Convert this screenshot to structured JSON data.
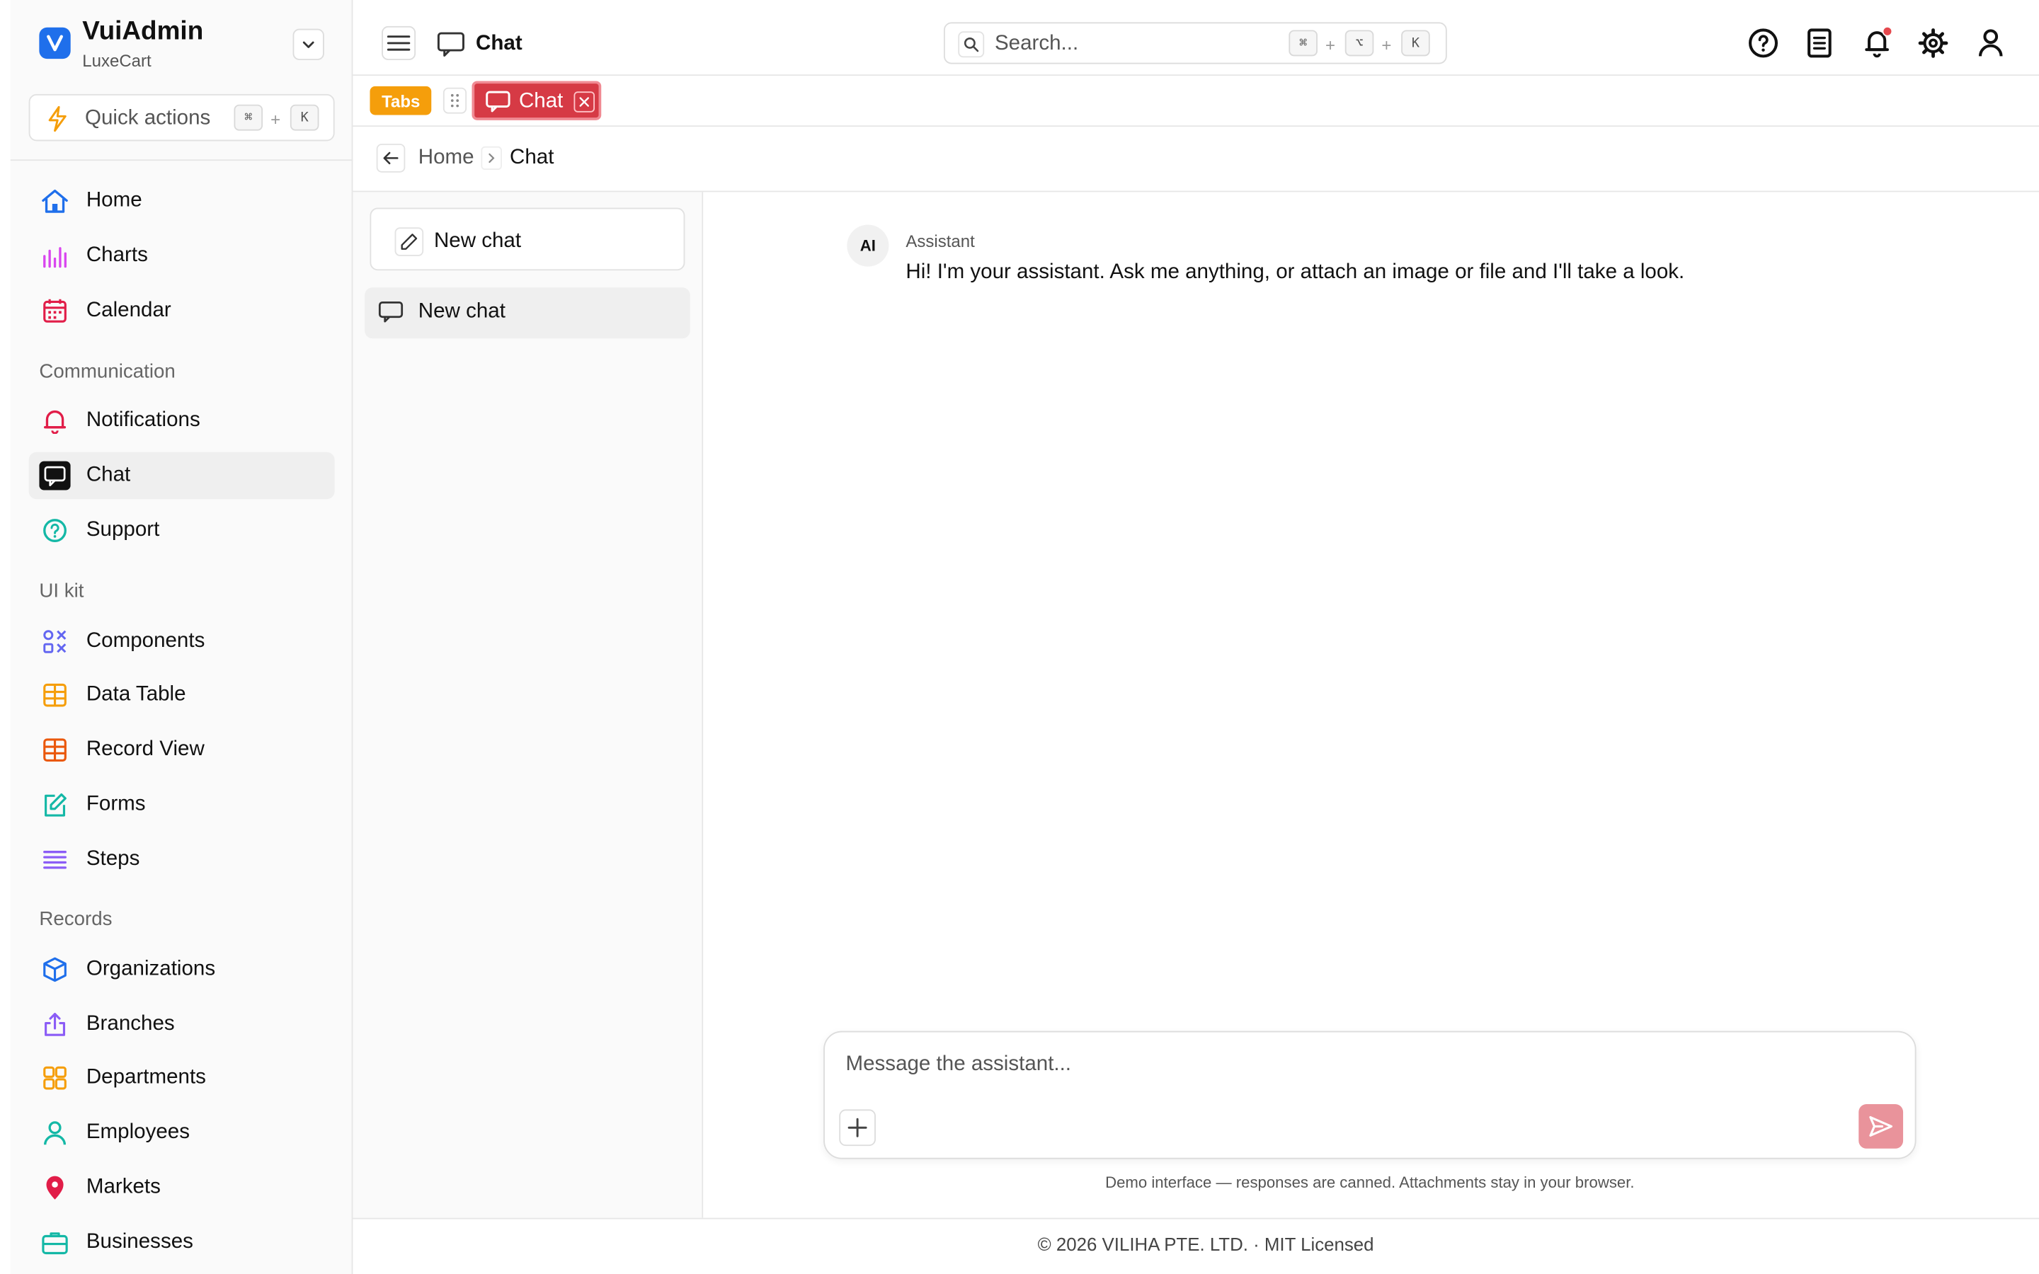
{
  "brand": {
    "title": "VuiAdmin",
    "subtitle": "LuxeCart",
    "logo_letter": "V",
    "color": "#1f6feb"
  },
  "quick_actions": {
    "label": "Quick actions",
    "keys": [
      "⌘",
      "K"
    ],
    "plus": "+"
  },
  "sidebar": {
    "top_items": [
      {
        "label": "Home",
        "icon": "home-icon"
      },
      {
        "label": "Charts",
        "icon": "bar-chart-icon"
      },
      {
        "label": "Calendar",
        "icon": "calendar-icon"
      }
    ],
    "sections": [
      {
        "title": "Communication",
        "items": [
          {
            "label": "Notifications",
            "icon": "bell-icon"
          },
          {
            "label": "Chat",
            "icon": "chat-icon",
            "active": true
          },
          {
            "label": "Support",
            "icon": "help-circle-icon"
          }
        ]
      },
      {
        "title": "UI kit",
        "items": [
          {
            "label": "Components",
            "icon": "components-icon"
          },
          {
            "label": "Data Table",
            "icon": "table-icon"
          },
          {
            "label": "Record View",
            "icon": "table-icon"
          },
          {
            "label": "Forms",
            "icon": "edit-square-icon"
          },
          {
            "label": "Steps",
            "icon": "list-icon"
          }
        ]
      },
      {
        "title": "Records",
        "items": [
          {
            "label": "Organizations",
            "icon": "cube-icon"
          },
          {
            "label": "Branches",
            "icon": "share-icon"
          },
          {
            "label": "Departments",
            "icon": "grid-icon"
          },
          {
            "label": "Employees",
            "icon": "user-icon"
          },
          {
            "label": "Markets",
            "icon": "map-pin-icon"
          },
          {
            "label": "Businesses",
            "icon": "briefcase-icon"
          }
        ]
      }
    ]
  },
  "header": {
    "title": "Chat",
    "search": {
      "placeholder": "Search...",
      "keys": [
        "⌘",
        "⌥",
        "K"
      ],
      "plus": "+"
    },
    "icons": [
      "help-icon",
      "document-icon",
      "bell-icon",
      "gear-icon",
      "user-icon"
    ]
  },
  "tabs": {
    "badge": "Tabs",
    "active_tab": "Chat"
  },
  "breadcrumb": {
    "home": "Home",
    "current": "Chat"
  },
  "chat_list": {
    "new_chat_button": "New chat",
    "conversations": [
      {
        "label": "New chat"
      }
    ]
  },
  "chat": {
    "messages": [
      {
        "avatar": "AI",
        "sender": "Assistant",
        "text": "Hi! I'm your assistant. Ask me anything, or attach an image or file and I'll take a look."
      }
    ],
    "composer_placeholder": "Message the assistant...",
    "disclaimer": "Demo interface — responses are canned. Attachments stay in your browser."
  },
  "footer": {
    "text": "© 2026 VILIHA PTE. LTD. · MIT Licensed"
  },
  "colors": {
    "accent": "#d63a45",
    "tabs_badge": "#f59e0b",
    "send": "#e9939b"
  }
}
